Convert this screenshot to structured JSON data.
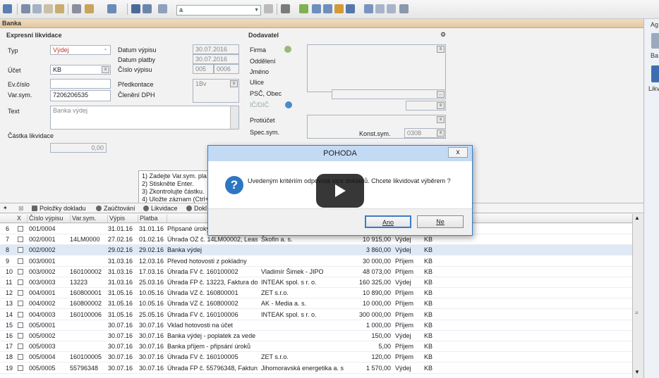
{
  "app": {
    "agenda_value": "a",
    "window_title": "Banka",
    "right_panel_labels": [
      "Ag",
      "Ba",
      "Likv"
    ]
  },
  "form": {
    "section_title": "Expresní likvidace",
    "typ_label": "Typ",
    "typ_value": "Výdej",
    "ucet_label": "Účet",
    "ucet_value": "KB",
    "evcislo_label": "Ev.číslo",
    "varsym_label": "Var.sym.",
    "varsym_value": "7206206535",
    "text_label": "Text",
    "text_value": "Banka výdej",
    "castka_label": "Částka likvidace",
    "castka_value": "0,00",
    "datum_vypisu_label": "Datum výpisu",
    "datum_vypisu_value": "30.07.2016",
    "datum_platby_label": "Datum platby",
    "datum_platby_value": "30.07.2016",
    "cislo_vypisu_label": "Číslo výpisu",
    "cislo_vypisu_a": "005",
    "cislo_vypisu_b": "0006",
    "predkontace_label": "Předkontace",
    "predkontace_value": "1Bv",
    "cleneni_label": "Členění DPH",
    "hint_text": "1) Zadejte Var.sym. pla\n2) Stiskněte Enter.\n3) Zkontrolujte částku.\n4) Uložte záznam (Ctrl+"
  },
  "dodavatel": {
    "section_title": "Dodavatel",
    "firma_label": "Firma",
    "oddeleni_label": "Oddělení",
    "jmeno_label": "Jméno",
    "ulice_label": "Ulice",
    "psc_label": "PSČ, Obec",
    "ic_label": "IČ/DIČ",
    "protiucet_label": "Protiúčet",
    "specsym_label": "Spec.sym.",
    "konstsym_label": "Konst.sym.",
    "konstsym_value": "0308"
  },
  "tabs": {
    "items": [
      "Položky dokladu",
      "Zaúčtování",
      "Likvidace",
      "Dokl"
    ]
  },
  "grid": {
    "headers": [
      "X",
      "Číslo výpisu",
      "Var.sym.",
      "Výpis",
      "Platba",
      "T"
    ],
    "rows": [
      {
        "n": "6",
        "cislo": "001/0004",
        "vs": "",
        "vypis": "31.01.16",
        "platba": "31.01.16",
        "text": "Připsané úroky",
        "firma": "",
        "castka": "",
        "typ": "",
        "ucet": ""
      },
      {
        "n": "7",
        "cislo": "002/0001",
        "vs": "14LM0000",
        "vypis": "27.02.16",
        "platba": "01.02.16",
        "text": "Úhrada OZ č. 14LM00002, Leasi",
        "firma": "Škofin a. s.",
        "castka": "10 915,00",
        "typ": "Výdej",
        "ucet": "KB"
      },
      {
        "n": "8",
        "cislo": "002/0002",
        "vs": "",
        "vypis": "29.02.16",
        "platba": "29.02.16",
        "text": "Banka výdej",
        "firma": "",
        "castka": "3 860,00",
        "typ": "Výdej",
        "ucet": "KB"
      },
      {
        "n": "9",
        "cislo": "003/0001",
        "vs": "",
        "vypis": "31.03.16",
        "platba": "12.03.16",
        "text": "Převod hotovosti z pokladny",
        "firma": "",
        "castka": "30 000,00",
        "typ": "Příjem",
        "ucet": "KB"
      },
      {
        "n": "10",
        "cislo": "003/0002",
        "vs": "160100002",
        "vypis": "31.03.16",
        "platba": "17.03.16",
        "text": "Úhrada FV č. 160100002",
        "firma": "Vladimír Šimek - JIPO",
        "castka": "48 073,00",
        "typ": "Příjem",
        "ucet": "KB"
      },
      {
        "n": "11",
        "cislo": "003/0003",
        "vs": "13223",
        "vypis": "31.03.16",
        "platba": "25.03.16",
        "text": "Úhrada FP č. 13223, Faktura do",
        "firma": "INTEAK spol. s r. o.",
        "castka": "160 325,00",
        "typ": "Výdej",
        "ucet": "KB"
      },
      {
        "n": "12",
        "cislo": "004/0001",
        "vs": "160800001",
        "vypis": "31.05.16",
        "platba": "10.05.16",
        "text": "Úhrada VZ č. 160800001",
        "firma": "ZET s.r.o.",
        "castka": "10 890,00",
        "typ": "Příjem",
        "ucet": "KB"
      },
      {
        "n": "13",
        "cislo": "004/0002",
        "vs": "160800002",
        "vypis": "31.05.16",
        "platba": "10.05.16",
        "text": "Úhrada VZ č. 160800002",
        "firma": "AK - Media a. s.",
        "castka": "10 000,00",
        "typ": "Příjem",
        "ucet": "KB"
      },
      {
        "n": "14",
        "cislo": "004/0003",
        "vs": "160100006",
        "vypis": "31.05.16",
        "platba": "25.05.16",
        "text": "Úhrada FV č. 160100006",
        "firma": "INTEAK spol. s r. o.",
        "castka": "300 000,00",
        "typ": "Příjem",
        "ucet": "KB"
      },
      {
        "n": "15",
        "cislo": "005/0001",
        "vs": "",
        "vypis": "30.07.16",
        "platba": "30.07.16",
        "text": "Vklad hotovosti na účet",
        "firma": "",
        "castka": "1 000,00",
        "typ": "Příjem",
        "ucet": "KB"
      },
      {
        "n": "16",
        "cislo": "005/0002",
        "vs": "",
        "vypis": "30.07.16",
        "platba": "30.07.16",
        "text": "Banka výdej - poplatek za vede",
        "firma": "",
        "castka": "150,00",
        "typ": "Výdej",
        "ucet": "KB"
      },
      {
        "n": "17",
        "cislo": "005/0003",
        "vs": "",
        "vypis": "30.07.16",
        "platba": "30.07.16",
        "text": "Banka příjem - připsání úroků",
        "firma": "",
        "castka": "5,00",
        "typ": "Příjem",
        "ucet": "KB"
      },
      {
        "n": "18",
        "cislo": "005/0004",
        "vs": "160100005",
        "vypis": "30.07.16",
        "platba": "30.07.16",
        "text": "Úhrada FV č. 160100005",
        "firma": "ZET s.r.o.",
        "castka": "120,00",
        "typ": "Příjem",
        "ucet": "KB"
      },
      {
        "n": "19",
        "cislo": "005/0005",
        "vs": "55796348",
        "vypis": "30.07.16",
        "platba": "30.07.16",
        "text": "Úhrada FP č. 55796348, Fakturuj",
        "firma": "Jihomoravská energetika a. s",
        "castka": "1 570,00",
        "typ": "Výdej",
        "ucet": "KB"
      }
    ]
  },
  "dialog": {
    "title": "POHODA",
    "close": "x",
    "message": "Uvedeným kritériím odpovídá více dokladů. Chcete likvidovat výběrem ?",
    "yes": "Ano",
    "no": "Ne"
  }
}
